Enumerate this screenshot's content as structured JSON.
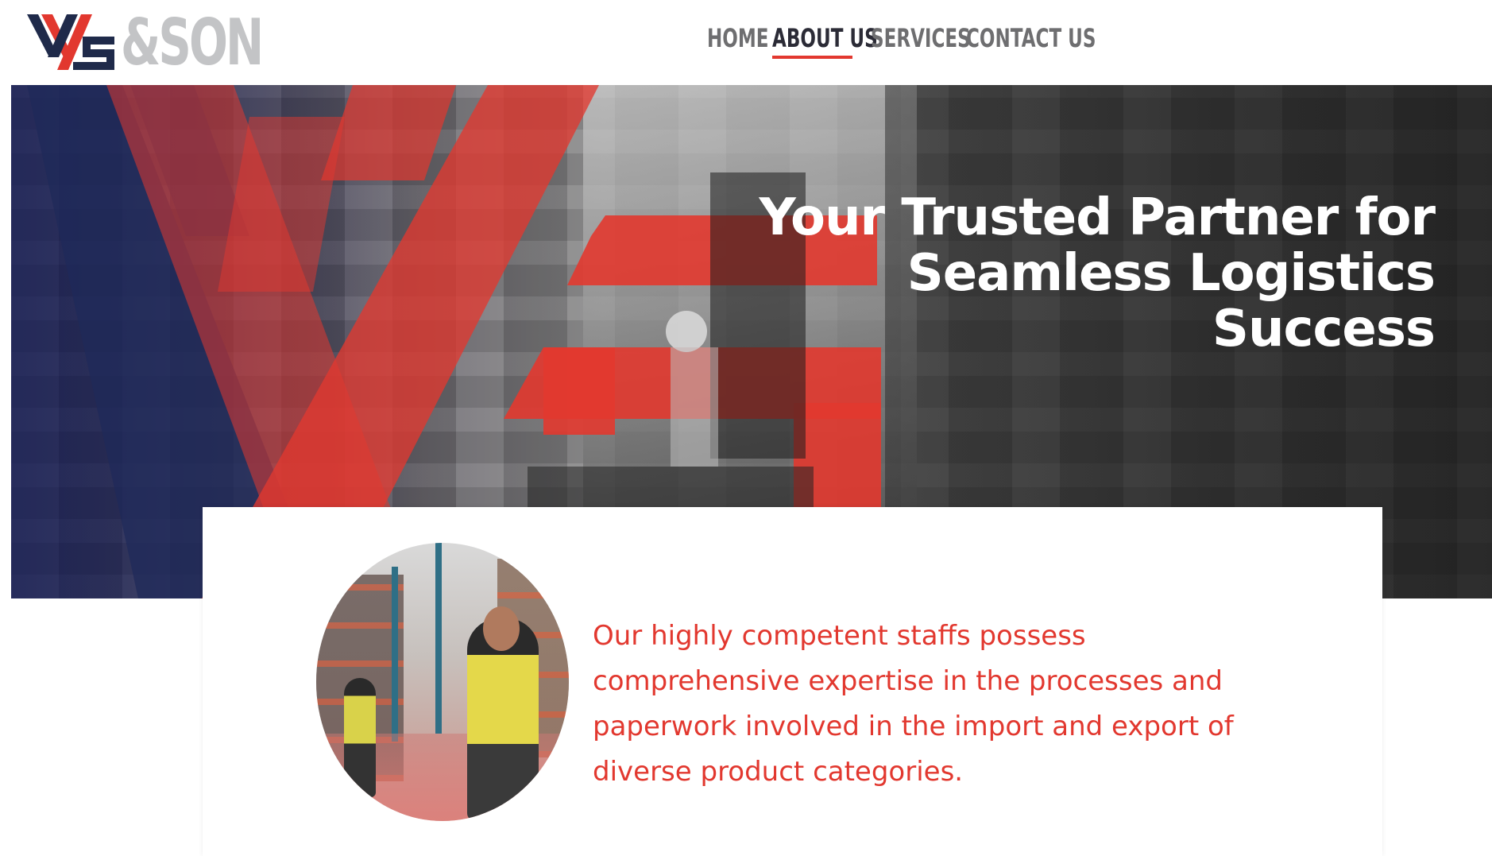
{
  "header": {
    "logo_text": "&SON",
    "logo_alt": "YS & SON logo",
    "nav": [
      {
        "label": "HOME"
      },
      {
        "label": "ABOUT US",
        "active": true
      },
      {
        "label": "SERVICES"
      },
      {
        "label": "CONTACT US"
      }
    ]
  },
  "hero": {
    "title_line1": "Your Trusted Partner for",
    "title_line2": "Seamless Logistics",
    "title_line3": "Success"
  },
  "card": {
    "text": "Our highly competent staffs possess comprehensive expertise in the processes and paperwork involved in the import and export of diverse product categories."
  },
  "colors": {
    "accent": "#e2382f",
    "navy": "#1f2a4a",
    "logo_gray": "#c3c4c6",
    "nav_text": "#6e6e70"
  }
}
